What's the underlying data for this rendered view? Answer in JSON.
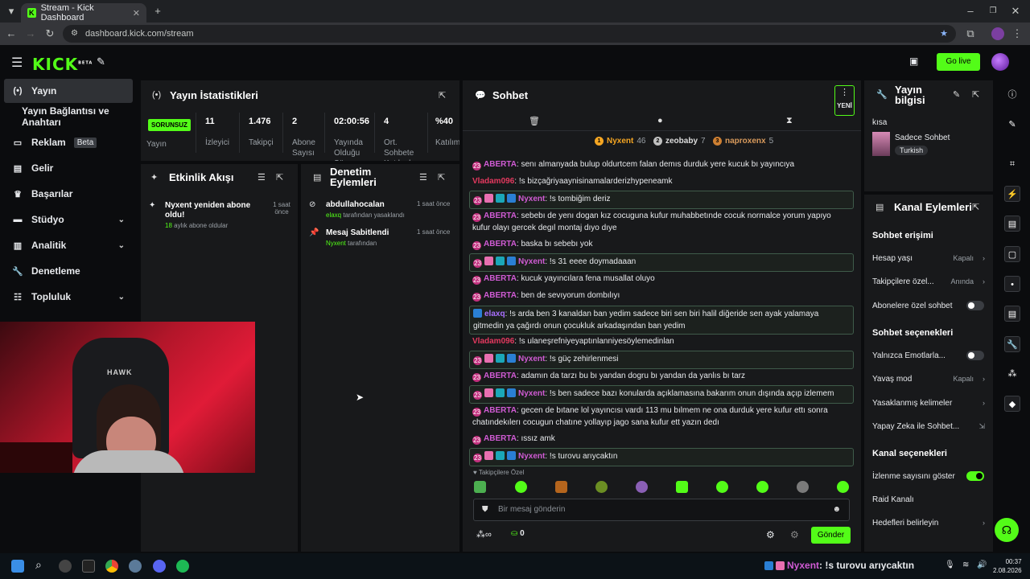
{
  "browser": {
    "tab_title": "Stream - Kick Dashboard",
    "url": "dashboard.kick.com/stream"
  },
  "app": {
    "logo": "KICK",
    "logo_beta": "BETA",
    "go_live": "Go live"
  },
  "nav": {
    "items": [
      {
        "label": "Yayın",
        "icon": "broadcast-icon"
      },
      {
        "label": "Yayın Bağlantısı ve Anahtarı",
        "icon": ""
      },
      {
        "label": "Reklam",
        "icon": "ad-icon",
        "badge": "Beta"
      },
      {
        "label": "Gelir",
        "icon": "chart-icon"
      },
      {
        "label": "Başarılar",
        "icon": "trophy-icon"
      },
      {
        "label": "Stüdyo",
        "icon": "studio-icon"
      },
      {
        "label": "Analitik",
        "icon": "analytics-icon"
      },
      {
        "label": "Denetleme",
        "icon": "wrench-icon"
      },
      {
        "label": "Topluluk",
        "icon": "community-icon"
      }
    ]
  },
  "stats": {
    "title": "Yayın İstatistikleri",
    "status": "SORUNSUZ",
    "status_label": "Yayın",
    "items": [
      {
        "value": "11",
        "label": "İzleyici"
      },
      {
        "value": "1.476",
        "label": "Takipçi"
      },
      {
        "value": "2",
        "label": "Abone Sayısı"
      },
      {
        "value": "02:00:56",
        "label": "Yayında Olduğu Süre"
      },
      {
        "value": "4",
        "label": "Ort. Sohbete Katılanlar"
      },
      {
        "value": "%40",
        "label": "Katılım"
      }
    ]
  },
  "activity": {
    "title": "Etkinlik Akışı",
    "items": [
      {
        "title": "Nyxent yeniden abone oldu!",
        "months": "18",
        "detail": "aylık abone oldular",
        "time": "1 saat önce"
      }
    ]
  },
  "moderation": {
    "title": "Denetim Eylemleri",
    "items": [
      {
        "title": "abdullahocalan",
        "actor": "elaxq",
        "detail": "tarafından yasaklandı",
        "time": "1 saat önce"
      },
      {
        "title": "Mesaj Sabitlendi",
        "actor": "Nyxent",
        "detail": "tarafından",
        "time": "1 saat önce"
      }
    ]
  },
  "chat": {
    "title": "Sohbet",
    "new_label": "YENİ",
    "leaderboard": [
      {
        "name": "Nyxent",
        "count": "46",
        "rank": "1",
        "color": "#f5a623"
      },
      {
        "name": "zeobaby",
        "count": "7",
        "rank": "2",
        "color": "#c0c0c0"
      },
      {
        "name": "naproxenx",
        "count": "5",
        "rank": "3",
        "color": "#cd7f32"
      }
    ],
    "messages": [
      {
        "user": "ABERTA",
        "cls": "u-aberta",
        "text": ": senı almanyada bulup oldurtcem falan demıs durduk yere kucuk bı yayıncıya",
        "hl": false,
        "badges": [
          "sub"
        ]
      },
      {
        "user": "Vladam096",
        "cls": "u-vlad",
        "text": ": !s bizçağriyaaynisinamalarderizhypeneamk",
        "hl": false,
        "badges": []
      },
      {
        "user": "Nyxent",
        "cls": "u-nyx",
        "text": ": !s tombiğim deriz",
        "hl": true,
        "badges": [
          "sub",
          "gift",
          "cyan",
          "blue"
        ]
      },
      {
        "user": "ABERTA",
        "cls": "u-aberta",
        "text": ": sebebı de yenı dogan kız cocuguna kufur muhabbetınde cocuk normalce yorum yapıyo kufur olayı gercek degıl montaj dıyo dıye",
        "hl": false,
        "badges": [
          "sub"
        ]
      },
      {
        "user": "ABERTA",
        "cls": "u-aberta",
        "text": ": baska bı sebebı yok",
        "hl": false,
        "badges": [
          "sub"
        ]
      },
      {
        "user": "Nyxent",
        "cls": "u-nyx",
        "text": ": !s 31 eeee doymadaaan",
        "hl": true,
        "badges": [
          "sub",
          "gift",
          "cyan",
          "blue"
        ]
      },
      {
        "user": "ABERTA",
        "cls": "u-aberta",
        "text": ": kucuk yayıncılara fena musallat oluyo",
        "hl": false,
        "badges": [
          "sub"
        ]
      },
      {
        "user": "ABERTA",
        "cls": "u-aberta",
        "text": ": ben de sevıyorum dombılıyı",
        "hl": false,
        "badges": [
          "sub"
        ]
      },
      {
        "user": "elaxq",
        "cls": "u-elaxq",
        "text": ": !s arda ben 3 kanaldan ban yedim sadece biri sen biri halil diğeride sen ayak yalamaya gitmedin ya çağırdı onun çocukluk arkadaşından ban yedim",
        "hl": true,
        "badges": [
          "blue"
        ]
      },
      {
        "user": "Vladam096",
        "cls": "u-vlad",
        "text": ": !s ulaneşrefniyeyaptınlanniyesöylemedinlan",
        "hl": false,
        "badges": []
      },
      {
        "user": "Nyxent",
        "cls": "u-nyx",
        "text": ": !s güç zehirlenmesi",
        "hl": true,
        "badges": [
          "sub",
          "gift",
          "cyan",
          "blue"
        ]
      },
      {
        "user": "ABERTA",
        "cls": "u-aberta",
        "text": ": adamın da tarzı bu bı yandan dogru bı yandan da yanlıs bı tarz",
        "hl": false,
        "badges": [
          "sub"
        ]
      },
      {
        "user": "Nyxent",
        "cls": "u-nyx",
        "text": ": !s ben sadece bazı konularda açıklamasına bakarım onun dışında açıp izlemem",
        "hl": true,
        "badges": [
          "sub",
          "gift",
          "cyan",
          "blue"
        ]
      },
      {
        "user": "ABERTA",
        "cls": "u-aberta",
        "text": ": gecen de bıtane lol yayıncısı vardı 113 mu bılmem ne ona durduk yere kufur ettı sonra chatındekılerı cocugun chatıne yollayıp jago sana kufur ett yazın dedı",
        "hl": false,
        "badges": [
          "sub"
        ]
      },
      {
        "user": "ABERTA",
        "cls": "u-aberta",
        "text": ": ıssız amk",
        "hl": false,
        "badges": [
          "sub"
        ]
      },
      {
        "user": "Nyxent",
        "cls": "u-nyx",
        "text": ": !s turovu arıycaktın",
        "hl": true,
        "badges": [
          "sub",
          "gift",
          "cyan",
          "blue"
        ]
      }
    ],
    "followers_only": "Takipçilere Özel",
    "input_placeholder": "Bir mesaj gönderin",
    "points": "0",
    "send": "Gönder"
  },
  "stream_info": {
    "title": "Yayın bilgisi",
    "stream_title": "kısa",
    "category": "Sadece Sohbet",
    "tag": "Turkish"
  },
  "channel_actions": {
    "title": "Kanal Eylemleri",
    "chat_access_head": "Sohbet erişimi",
    "age_label": "Hesap yaşı",
    "age_value": "Kapalı",
    "followers_label": "Takipçilere özel...",
    "followers_value": "Anında",
    "subs_label": "Abonelere özel sohbet",
    "chat_options_head": "Sohbet seçenekleri",
    "emotes_label": "Yalnızca Emotlarla...",
    "slow_label": "Yavaş mod",
    "slow_value": "Kapalı",
    "banned_words_label": "Yasaklanmış kelimeler",
    "ai_label": "Yapay Zeka ile Sohbet...",
    "channel_options_head": "Kanal seçenekleri",
    "view_count_label": "İzlenme sayısını göster",
    "raid_label": "Raid Kanalı",
    "hedefler_label": "Hedefleri belirleyin"
  },
  "overlay": {
    "user": "Nyxent",
    "text": ": !s turovu arıycaktın"
  },
  "taskbar": {
    "time": "00:37",
    "date": "2.08.2026"
  },
  "colors": {
    "brand": "#53fc18",
    "panel": "#18191b"
  }
}
